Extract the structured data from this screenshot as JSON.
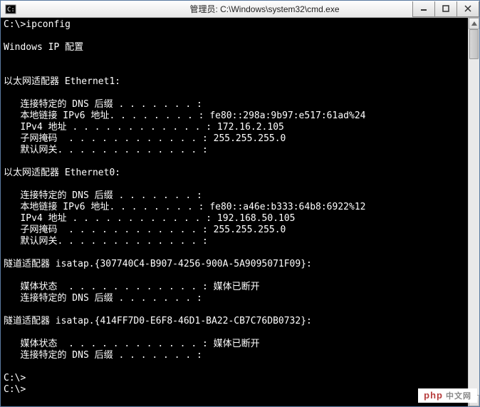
{
  "window": {
    "title": "管理员: C:\\Windows\\system32\\cmd.exe"
  },
  "terminal": {
    "prompt1": "C:\\>ipconfig",
    "blank": "",
    "header": "Windows IP 配置",
    "adapters": [
      {
        "title": "以太网适配器 Ethernet1:",
        "lines": [
          {
            "label": "   连接特定的 DNS 后缀",
            "dots": " . . . . . . . :",
            "value": ""
          },
          {
            "label": "   本地链接 IPv6 地址",
            "dots": ". . . . . . . . :",
            "value": " fe80::298a:9b97:e517:61ad%24"
          },
          {
            "label": "   IPv4 地址 ",
            "dots": ". . . . . . . . . . . . :",
            "value": " 172.16.2.105"
          },
          {
            "label": "   子网掩码  ",
            "dots": ". . . . . . . . . . . . :",
            "value": " 255.255.255.0"
          },
          {
            "label": "   默认网关",
            "dots": ". . . . . . . . . . . . . :",
            "value": ""
          }
        ]
      },
      {
        "title": "以太网适配器 Ethernet0:",
        "lines": [
          {
            "label": "   连接特定的 DNS 后缀",
            "dots": " . . . . . . . :",
            "value": ""
          },
          {
            "label": "   本地链接 IPv6 地址",
            "dots": ". . . . . . . . :",
            "value": " fe80::a46e:b333:64b8:6922%12"
          },
          {
            "label": "   IPv4 地址 ",
            "dots": ". . . . . . . . . . . . :",
            "value": " 192.168.50.105"
          },
          {
            "label": "   子网掩码  ",
            "dots": ". . . . . . . . . . . . :",
            "value": " 255.255.255.0"
          },
          {
            "label": "   默认网关",
            "dots": ". . . . . . . . . . . . . :",
            "value": ""
          }
        ]
      },
      {
        "title": "隧道适配器 isatap.{307740C4-B907-4256-900A-5A9095071F09}:",
        "lines": [
          {
            "label": "   媒体状态  ",
            "dots": ". . . . . . . . . . . . :",
            "value": " 媒体已断开"
          },
          {
            "label": "   连接特定的 DNS 后缀",
            "dots": " . . . . . . . :",
            "value": ""
          }
        ]
      },
      {
        "title": "隧道适配器 isatap.{414FF7D0-E6F8-46D1-BA22-CB7C76DB0732}:",
        "lines": [
          {
            "label": "   媒体状态  ",
            "dots": ". . . . . . . . . . . . :",
            "value": " 媒体已断开"
          },
          {
            "label": "   连接特定的 DNS 后缀",
            "dots": " . . . . . . . :",
            "value": ""
          }
        ]
      }
    ],
    "prompt2": "C:\\>",
    "prompt3": "C:\\>"
  },
  "watermark": {
    "text": "php",
    "cn": "中文网"
  }
}
